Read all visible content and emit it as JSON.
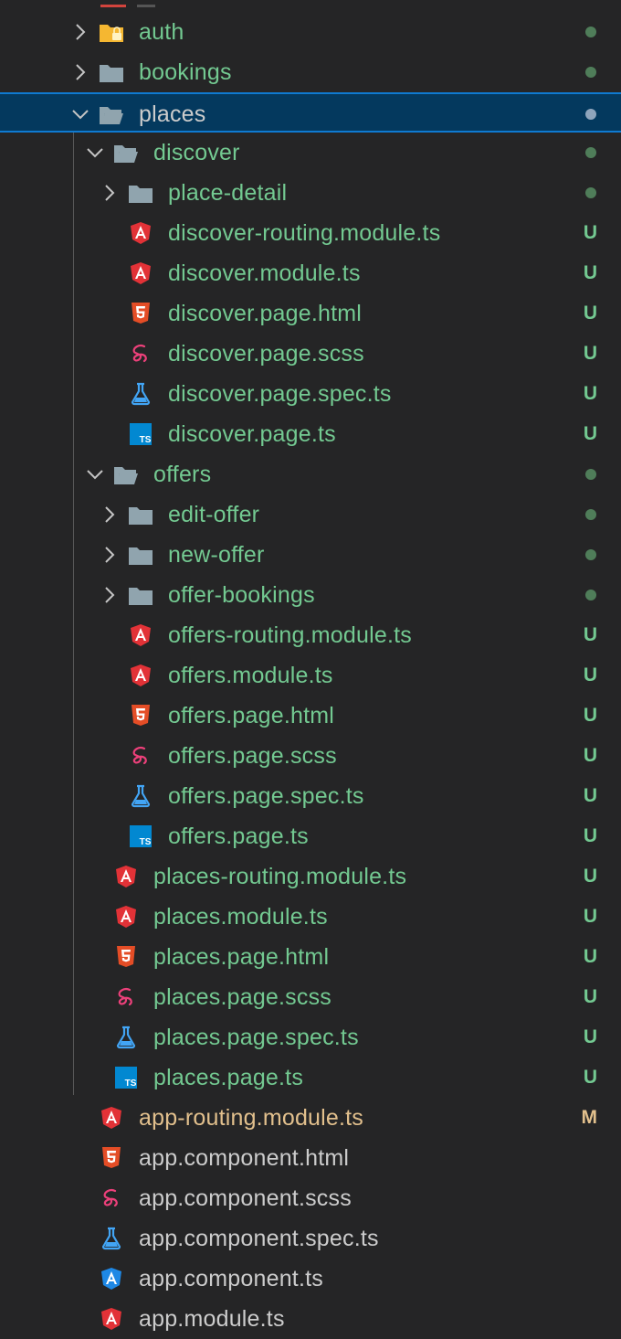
{
  "colors": {
    "untracked": "#73c991",
    "modified": "#e2c08d",
    "default_text": "#cccccc",
    "selected_bg": "#04395e",
    "selected_border": "#0f7ad1",
    "dot_green": "#4f7d59",
    "dot_selected": "#8fa5bc"
  },
  "tree": {
    "rows": [
      {
        "label": "auth",
        "type": "folder",
        "icon": "folder-lock-icon",
        "expanded": false,
        "depth": 0,
        "status": "dot",
        "color": "untracked"
      },
      {
        "label": "bookings",
        "type": "folder",
        "icon": "folder-icon",
        "expanded": false,
        "depth": 0,
        "status": "dot",
        "color": "untracked"
      },
      {
        "label": "places",
        "type": "folder",
        "icon": "folder-open-icon",
        "expanded": true,
        "depth": 0,
        "status": "dot",
        "color": "default",
        "selected": true
      },
      {
        "label": "discover",
        "type": "folder",
        "icon": "folder-open-icon",
        "expanded": true,
        "depth": 1,
        "status": "dot",
        "color": "untracked"
      },
      {
        "label": "place-detail",
        "type": "folder",
        "icon": "folder-icon",
        "expanded": false,
        "depth": 2,
        "status": "dot",
        "color": "untracked"
      },
      {
        "label": "discover-routing.module.ts",
        "type": "file",
        "icon": "angular-icon",
        "depth": 2,
        "status": "U",
        "color": "untracked"
      },
      {
        "label": "discover.module.ts",
        "type": "file",
        "icon": "angular-icon",
        "depth": 2,
        "status": "U",
        "color": "untracked"
      },
      {
        "label": "discover.page.html",
        "type": "file",
        "icon": "html5-icon",
        "depth": 2,
        "status": "U",
        "color": "untracked"
      },
      {
        "label": "discover.page.scss",
        "type": "file",
        "icon": "sass-icon",
        "depth": 2,
        "status": "U",
        "color": "untracked"
      },
      {
        "label": "discover.page.spec.ts",
        "type": "file",
        "icon": "test-flask-icon",
        "depth": 2,
        "status": "U",
        "color": "untracked"
      },
      {
        "label": "discover.page.ts",
        "type": "file",
        "icon": "typescript-icon",
        "depth": 2,
        "status": "U",
        "color": "untracked"
      },
      {
        "label": "offers",
        "type": "folder",
        "icon": "folder-open-icon",
        "expanded": true,
        "depth": 1,
        "status": "dot",
        "color": "untracked"
      },
      {
        "label": "edit-offer",
        "type": "folder",
        "icon": "folder-icon",
        "expanded": false,
        "depth": 2,
        "status": "dot",
        "color": "untracked"
      },
      {
        "label": "new-offer",
        "type": "folder",
        "icon": "folder-icon",
        "expanded": false,
        "depth": 2,
        "status": "dot",
        "color": "untracked"
      },
      {
        "label": "offer-bookings",
        "type": "folder",
        "icon": "folder-icon",
        "expanded": false,
        "depth": 2,
        "status": "dot",
        "color": "untracked"
      },
      {
        "label": "offers-routing.module.ts",
        "type": "file",
        "icon": "angular-icon",
        "depth": 2,
        "status": "U",
        "color": "untracked"
      },
      {
        "label": "offers.module.ts",
        "type": "file",
        "icon": "angular-icon",
        "depth": 2,
        "status": "U",
        "color": "untracked"
      },
      {
        "label": "offers.page.html",
        "type": "file",
        "icon": "html5-icon",
        "depth": 2,
        "status": "U",
        "color": "untracked"
      },
      {
        "label": "offers.page.scss",
        "type": "file",
        "icon": "sass-icon",
        "depth": 2,
        "status": "U",
        "color": "untracked"
      },
      {
        "label": "offers.page.spec.ts",
        "type": "file",
        "icon": "test-flask-icon",
        "depth": 2,
        "status": "U",
        "color": "untracked"
      },
      {
        "label": "offers.page.ts",
        "type": "file",
        "icon": "typescript-icon",
        "depth": 2,
        "status": "U",
        "color": "untracked"
      },
      {
        "label": "places-routing.module.ts",
        "type": "file",
        "icon": "angular-icon",
        "depth": 1,
        "status": "U",
        "color": "untracked"
      },
      {
        "label": "places.module.ts",
        "type": "file",
        "icon": "angular-icon",
        "depth": 1,
        "status": "U",
        "color": "untracked"
      },
      {
        "label": "places.page.html",
        "type": "file",
        "icon": "html5-icon",
        "depth": 1,
        "status": "U",
        "color": "untracked"
      },
      {
        "label": "places.page.scss",
        "type": "file",
        "icon": "sass-icon",
        "depth": 1,
        "status": "U",
        "color": "untracked"
      },
      {
        "label": "places.page.spec.ts",
        "type": "file",
        "icon": "test-flask-icon",
        "depth": 1,
        "status": "U",
        "color": "untracked"
      },
      {
        "label": "places.page.ts",
        "type": "file",
        "icon": "typescript-icon",
        "depth": 1,
        "status": "U",
        "color": "untracked"
      },
      {
        "label": "app-routing.module.ts",
        "type": "file",
        "icon": "angular-icon",
        "depth": 0,
        "status": "M",
        "color": "modified"
      },
      {
        "label": "app.component.html",
        "type": "file",
        "icon": "html5-icon",
        "depth": 0,
        "status": "",
        "color": "default"
      },
      {
        "label": "app.component.scss",
        "type": "file",
        "icon": "sass-icon",
        "depth": 0,
        "status": "",
        "color": "default"
      },
      {
        "label": "app.component.spec.ts",
        "type": "file",
        "icon": "test-flask-icon",
        "depth": 0,
        "status": "",
        "color": "default"
      },
      {
        "label": "app.component.ts",
        "type": "file",
        "icon": "angular-component-icon",
        "depth": 0,
        "status": "",
        "color": "default"
      },
      {
        "label": "app.module.ts",
        "type": "file",
        "icon": "angular-icon",
        "depth": 0,
        "status": "",
        "color": "default"
      }
    ]
  }
}
